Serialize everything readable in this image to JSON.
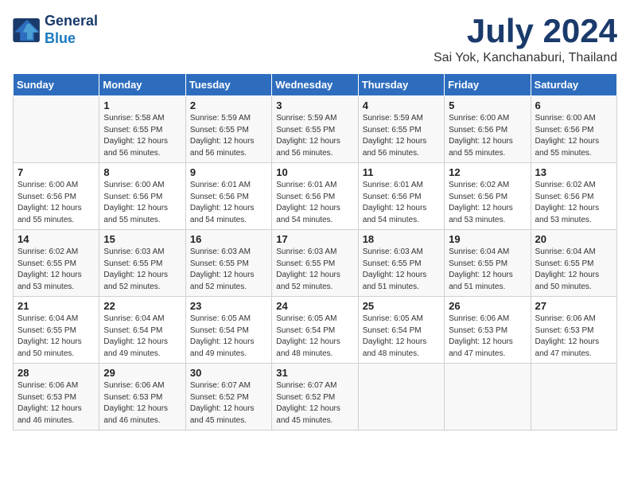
{
  "logo": {
    "line1": "General",
    "line2": "Blue"
  },
  "title": "July 2024",
  "location": "Sai Yok, Kanchanaburi, Thailand",
  "days_header": [
    "Sunday",
    "Monday",
    "Tuesday",
    "Wednesday",
    "Thursday",
    "Friday",
    "Saturday"
  ],
  "weeks": [
    [
      {
        "num": "",
        "info": ""
      },
      {
        "num": "1",
        "info": "Sunrise: 5:58 AM\nSunset: 6:55 PM\nDaylight: 12 hours\nand 56 minutes."
      },
      {
        "num": "2",
        "info": "Sunrise: 5:59 AM\nSunset: 6:55 PM\nDaylight: 12 hours\nand 56 minutes."
      },
      {
        "num": "3",
        "info": "Sunrise: 5:59 AM\nSunset: 6:55 PM\nDaylight: 12 hours\nand 56 minutes."
      },
      {
        "num": "4",
        "info": "Sunrise: 5:59 AM\nSunset: 6:55 PM\nDaylight: 12 hours\nand 56 minutes."
      },
      {
        "num": "5",
        "info": "Sunrise: 6:00 AM\nSunset: 6:56 PM\nDaylight: 12 hours\nand 55 minutes."
      },
      {
        "num": "6",
        "info": "Sunrise: 6:00 AM\nSunset: 6:56 PM\nDaylight: 12 hours\nand 55 minutes."
      }
    ],
    [
      {
        "num": "7",
        "info": "Sunrise: 6:00 AM\nSunset: 6:56 PM\nDaylight: 12 hours\nand 55 minutes."
      },
      {
        "num": "8",
        "info": "Sunrise: 6:00 AM\nSunset: 6:56 PM\nDaylight: 12 hours\nand 55 minutes."
      },
      {
        "num": "9",
        "info": "Sunrise: 6:01 AM\nSunset: 6:56 PM\nDaylight: 12 hours\nand 54 minutes."
      },
      {
        "num": "10",
        "info": "Sunrise: 6:01 AM\nSunset: 6:56 PM\nDaylight: 12 hours\nand 54 minutes."
      },
      {
        "num": "11",
        "info": "Sunrise: 6:01 AM\nSunset: 6:56 PM\nDaylight: 12 hours\nand 54 minutes."
      },
      {
        "num": "12",
        "info": "Sunrise: 6:02 AM\nSunset: 6:56 PM\nDaylight: 12 hours\nand 53 minutes."
      },
      {
        "num": "13",
        "info": "Sunrise: 6:02 AM\nSunset: 6:56 PM\nDaylight: 12 hours\nand 53 minutes."
      }
    ],
    [
      {
        "num": "14",
        "info": "Sunrise: 6:02 AM\nSunset: 6:55 PM\nDaylight: 12 hours\nand 53 minutes."
      },
      {
        "num": "15",
        "info": "Sunrise: 6:03 AM\nSunset: 6:55 PM\nDaylight: 12 hours\nand 52 minutes."
      },
      {
        "num": "16",
        "info": "Sunrise: 6:03 AM\nSunset: 6:55 PM\nDaylight: 12 hours\nand 52 minutes."
      },
      {
        "num": "17",
        "info": "Sunrise: 6:03 AM\nSunset: 6:55 PM\nDaylight: 12 hours\nand 52 minutes."
      },
      {
        "num": "18",
        "info": "Sunrise: 6:03 AM\nSunset: 6:55 PM\nDaylight: 12 hours\nand 51 minutes."
      },
      {
        "num": "19",
        "info": "Sunrise: 6:04 AM\nSunset: 6:55 PM\nDaylight: 12 hours\nand 51 minutes."
      },
      {
        "num": "20",
        "info": "Sunrise: 6:04 AM\nSunset: 6:55 PM\nDaylight: 12 hours\nand 50 minutes."
      }
    ],
    [
      {
        "num": "21",
        "info": "Sunrise: 6:04 AM\nSunset: 6:55 PM\nDaylight: 12 hours\nand 50 minutes."
      },
      {
        "num": "22",
        "info": "Sunrise: 6:04 AM\nSunset: 6:54 PM\nDaylight: 12 hours\nand 49 minutes."
      },
      {
        "num": "23",
        "info": "Sunrise: 6:05 AM\nSunset: 6:54 PM\nDaylight: 12 hours\nand 49 minutes."
      },
      {
        "num": "24",
        "info": "Sunrise: 6:05 AM\nSunset: 6:54 PM\nDaylight: 12 hours\nand 48 minutes."
      },
      {
        "num": "25",
        "info": "Sunrise: 6:05 AM\nSunset: 6:54 PM\nDaylight: 12 hours\nand 48 minutes."
      },
      {
        "num": "26",
        "info": "Sunrise: 6:06 AM\nSunset: 6:53 PM\nDaylight: 12 hours\nand 47 minutes."
      },
      {
        "num": "27",
        "info": "Sunrise: 6:06 AM\nSunset: 6:53 PM\nDaylight: 12 hours\nand 47 minutes."
      }
    ],
    [
      {
        "num": "28",
        "info": "Sunrise: 6:06 AM\nSunset: 6:53 PM\nDaylight: 12 hours\nand 46 minutes."
      },
      {
        "num": "29",
        "info": "Sunrise: 6:06 AM\nSunset: 6:53 PM\nDaylight: 12 hours\nand 46 minutes."
      },
      {
        "num": "30",
        "info": "Sunrise: 6:07 AM\nSunset: 6:52 PM\nDaylight: 12 hours\nand 45 minutes."
      },
      {
        "num": "31",
        "info": "Sunrise: 6:07 AM\nSunset: 6:52 PM\nDaylight: 12 hours\nand 45 minutes."
      },
      {
        "num": "",
        "info": ""
      },
      {
        "num": "",
        "info": ""
      },
      {
        "num": "",
        "info": ""
      }
    ]
  ]
}
